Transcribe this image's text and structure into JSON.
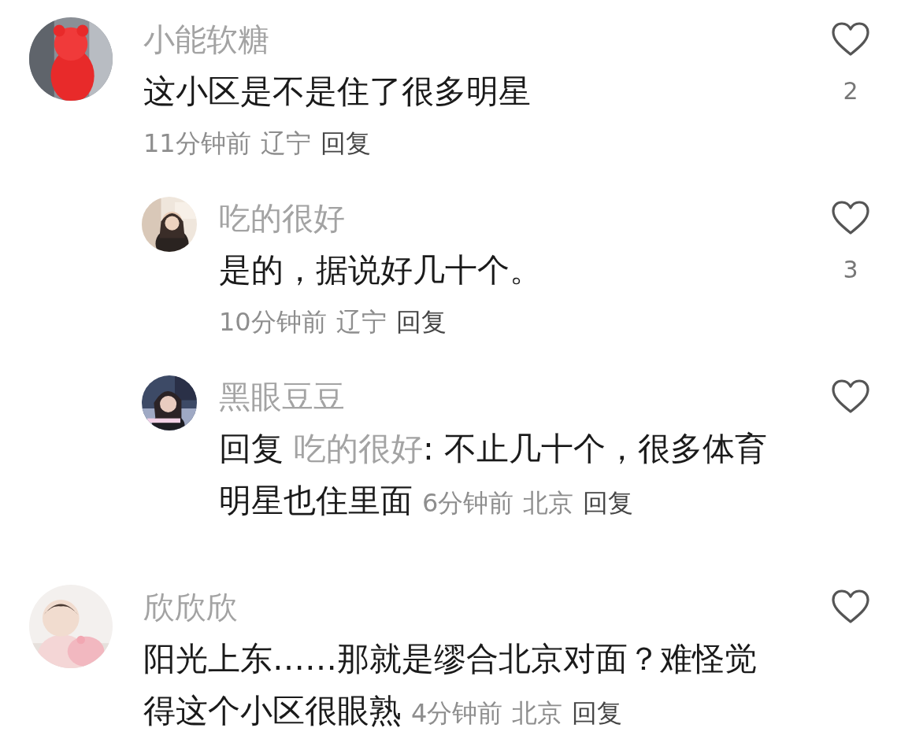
{
  "comments": [
    {
      "author": "小能软糖",
      "text": "这小区是不是住了很多明星",
      "time": "11分钟前",
      "location": "辽宁",
      "reply_label": "回复",
      "likes": "2",
      "meta_inline": false,
      "replies": [
        {
          "author": "吃的很好",
          "text": "是的，据说好几十个。",
          "time": "10分钟前",
          "location": "辽宁",
          "reply_label": "回复",
          "likes": "3",
          "meta_inline": false
        },
        {
          "author": "黑眼豆豆",
          "reply_prefix": "回复",
          "reply_to": "吃的很好",
          "text": ": 不止几十个，很多体育明星也住里面",
          "time": "6分钟前",
          "location": "北京",
          "reply_label": "回复",
          "meta_inline": true
        }
      ]
    },
    {
      "author": "欣欣欣",
      "text": "阳光上东……那就是缪合北京对面？难怪觉得这个小区很眼熟",
      "time": "4分钟前",
      "location": "北京",
      "reply_label": "回复",
      "meta_inline": true
    }
  ]
}
